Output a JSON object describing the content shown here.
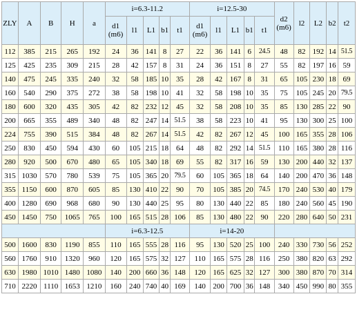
{
  "headers": {
    "model": "ZLY",
    "A": "A",
    "B": "B",
    "H": "H",
    "a": "a",
    "group1": "i=6.3-11.2",
    "group2": "i=12.5-30",
    "d1_line1": "d1",
    "d1_line2": "(m6)",
    "l1": "l1",
    "L1": "L1",
    "b1": "b1",
    "t1": "t1",
    "d2_line1": "d2",
    "d2_line2": "(m6)",
    "l2": "l2",
    "L2": "L2",
    "b2": "b2",
    "t2": "t2"
  },
  "rows_top": [
    [
      "112",
      "385",
      "215",
      "265",
      "192",
      "24",
      "36",
      "141",
      "8",
      "27",
      "22",
      "36",
      "141",
      "6",
      "24.5",
      "48",
      "82",
      "192",
      "14",
      "51.5"
    ],
    [
      "125",
      "425",
      "235",
      "309",
      "215",
      "28",
      "42",
      "157",
      "8",
      "31",
      "24",
      "36",
      "151",
      "8",
      "27",
      "55",
      "82",
      "197",
      "16",
      "59"
    ],
    [
      "140",
      "475",
      "245",
      "335",
      "240",
      "32",
      "58",
      "185",
      "10",
      "35",
      "28",
      "42",
      "167",
      "8",
      "31",
      "65",
      "105",
      "230",
      "18",
      "69"
    ],
    [
      "160",
      "540",
      "290",
      "375",
      "272",
      "38",
      "58",
      "198",
      "10",
      "41",
      "32",
      "58",
      "198",
      "10",
      "35",
      "75",
      "105",
      "245",
      "20",
      "79.5"
    ],
    [
      "180",
      "600",
      "320",
      "435",
      "305",
      "42",
      "82",
      "232",
      "12",
      "45",
      "32",
      "58",
      "208",
      "10",
      "35",
      "85",
      "130",
      "285",
      "22",
      "90"
    ],
    [
      "200",
      "665",
      "355",
      "489",
      "340",
      "48",
      "82",
      "247",
      "14",
      "51.5",
      "38",
      "58",
      "223",
      "10",
      "41",
      "95",
      "130",
      "300",
      "25",
      "100"
    ],
    [
      "224",
      "755",
      "390",
      "515",
      "384",
      "48",
      "82",
      "267",
      "14",
      "51.5",
      "42",
      "82",
      "267",
      "12",
      "45",
      "100",
      "165",
      "355",
      "28",
      "106"
    ],
    [
      "250",
      "830",
      "450",
      "594",
      "430",
      "60",
      "105",
      "215",
      "18",
      "64",
      "48",
      "82",
      "292",
      "14",
      "51.5",
      "110",
      "165",
      "380",
      "28",
      "116"
    ],
    [
      "280",
      "920",
      "500",
      "670",
      "480",
      "65",
      "105",
      "340",
      "18",
      "69",
      "55",
      "82",
      "317",
      "16",
      "59",
      "130",
      "200",
      "440",
      "32",
      "137"
    ],
    [
      "315",
      "1030",
      "570",
      "780",
      "539",
      "75",
      "105",
      "365",
      "20",
      "79.5",
      "60",
      "105",
      "365",
      "18",
      "64",
      "140",
      "200",
      "470",
      "36",
      "148"
    ],
    [
      "355",
      "1150",
      "600",
      "870",
      "605",
      "85",
      "130",
      "410",
      "22",
      "90",
      "70",
      "105",
      "385",
      "20",
      "74.5",
      "170",
      "240",
      "530",
      "40",
      "179"
    ],
    [
      "400",
      "1280",
      "690",
      "968",
      "680",
      "90",
      "130",
      "440",
      "25",
      "95",
      "80",
      "130",
      "440",
      "22",
      "85",
      "180",
      "240",
      "560",
      "45",
      "190"
    ],
    [
      "450",
      "1450",
      "750",
      "1065",
      "765",
      "100",
      "165",
      "515",
      "28",
      "106",
      "85",
      "130",
      "480",
      "22",
      "90",
      "220",
      "280",
      "640",
      "50",
      "231"
    ]
  ],
  "band": {
    "group1": "i=6.3-12.5",
    "group2": "i=14-20"
  },
  "rows_bottom": [
    [
      "500",
      "1600",
      "830",
      "1190",
      "855",
      "110",
      "165",
      "555",
      "28",
      "116",
      "95",
      "130",
      "520",
      "25",
      "100",
      "240",
      "330",
      "730",
      "56",
      "252"
    ],
    [
      "560",
      "1760",
      "910",
      "1320",
      "960",
      "120",
      "165",
      "575",
      "32",
      "127",
      "110",
      "165",
      "575",
      "28",
      "116",
      "250",
      "380",
      "820",
      "63",
      "292"
    ],
    [
      "630",
      "1980",
      "1010",
      "1480",
      "1080",
      "140",
      "200",
      "660",
      "36",
      "148",
      "120",
      "165",
      "625",
      "32",
      "127",
      "300",
      "380",
      "870",
      "70",
      "314"
    ],
    [
      "710",
      "2220",
      "1110",
      "1653",
      "1210",
      "160",
      "240",
      "740",
      "40",
      "169",
      "140",
      "200",
      "700",
      "36",
      "148",
      "340",
      "450",
      "990",
      "80",
      "355"
    ]
  ]
}
